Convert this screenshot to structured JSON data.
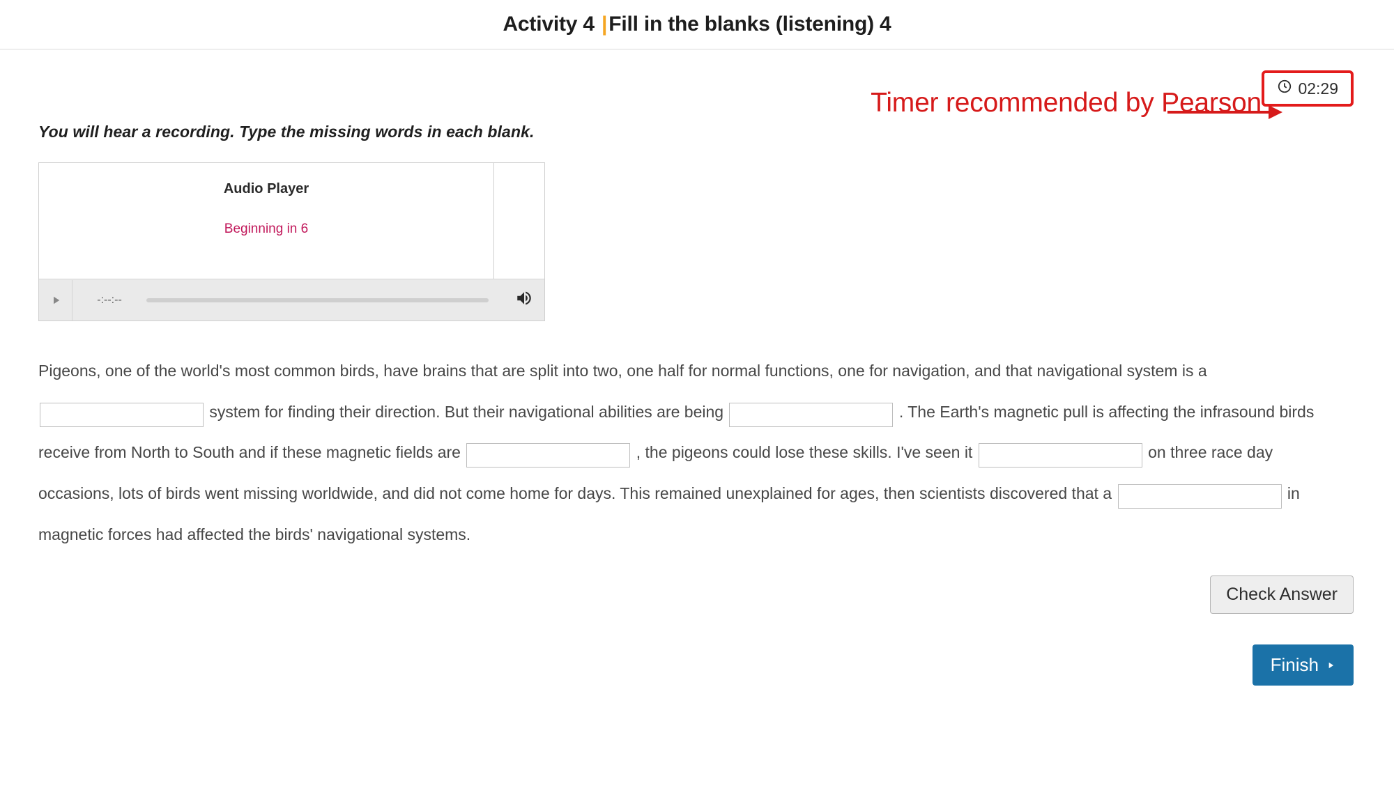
{
  "header": {
    "activity_prefix": "Activity 4 ",
    "activity_title": "Fill in the blanks (listening) 4"
  },
  "timer": {
    "value": "02:29"
  },
  "annotation": {
    "text": "Timer recommended by Pearson"
  },
  "instruction": "You will hear a recording. Type the missing words in each blank.",
  "audio_player": {
    "title": "Audio Player",
    "countdown": "Beginning in 6",
    "time": "-:--:--"
  },
  "passage": {
    "segments": [
      "Pigeons, one of the world's most common birds, have brains that are split into two, one half for normal functions, one for navigation, and that navigational system is a ",
      " system for finding their direction. But their navigational abilities are being ",
      ". The Earth's magnetic pull is affecting the infrasound birds receive from North to South and if these magnetic fields are ",
      ", the pigeons could lose these skills. I've seen it ",
      " on three race day occasions, lots of birds went missing worldwide, and did not come home for days. This remained unexplained for ages, then scientists discovered that a ",
      " in magnetic forces had affected the birds' navigational systems."
    ]
  },
  "buttons": {
    "check_answer": "Check Answer",
    "finish": "Finish"
  }
}
